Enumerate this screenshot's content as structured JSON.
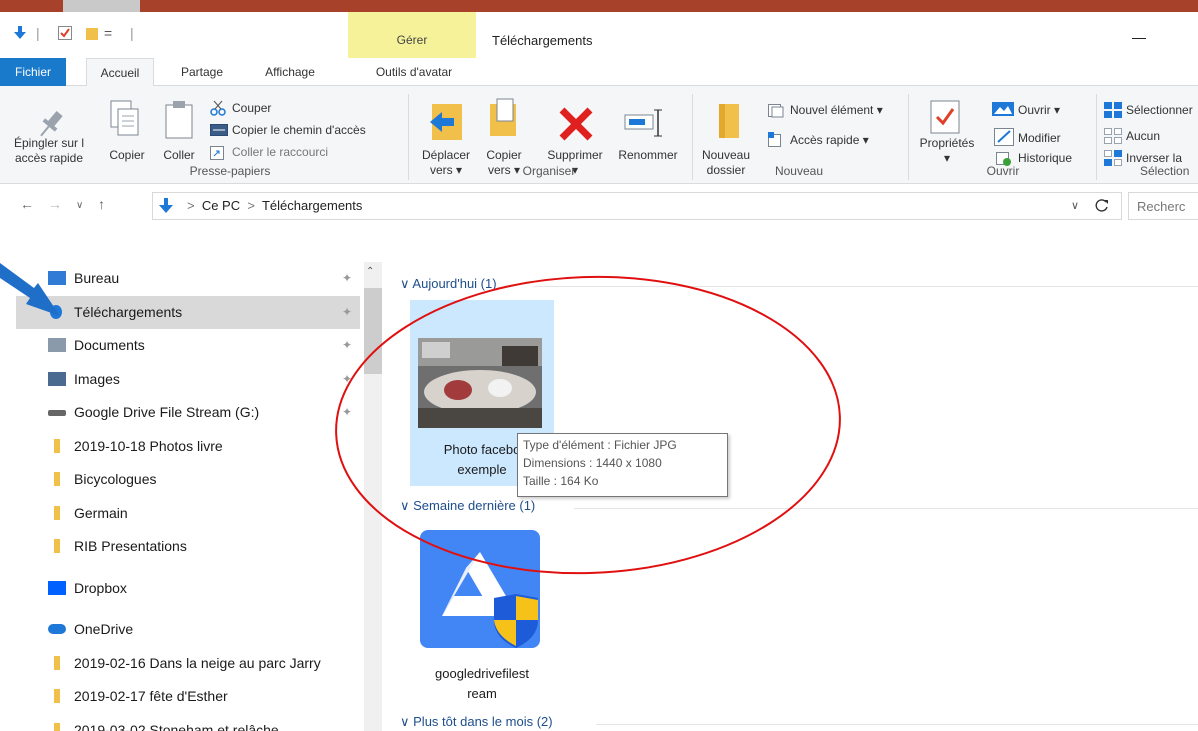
{
  "window": {
    "title": "Téléchargements",
    "context_tab_group": "Gérer",
    "accent_color": "#a8412a"
  },
  "quick_access": {
    "separator": "|",
    "dropdown": "="
  },
  "ribbon_tabs": [
    {
      "label": "Fichier"
    },
    {
      "label": "Accueil"
    },
    {
      "label": "Partage"
    },
    {
      "label": "Affichage"
    },
    {
      "label": "Outils d'avatar"
    }
  ],
  "ribbon": {
    "presse_papiers": {
      "label": "Presse-papiers",
      "pin_line1": "Épingler sur l",
      "pin_line2": "accès rapide",
      "copy": "Copier",
      "paste": "Coller",
      "cut": "Couper",
      "copy_path": "Copier le chemin d'accès",
      "paste_shortcut": "Coller le raccourci"
    },
    "organiser": {
      "label": "Organiser",
      "move_line1": "Déplacer",
      "move_line2": "vers ▾",
      "copy_line1": "Copier",
      "copy_line2": "vers ▾",
      "delete": "Supprimer",
      "delete_arrow": "▾",
      "rename": "Renommer"
    },
    "nouveau": {
      "label": "Nouveau",
      "new_folder_line1": "Nouveau",
      "new_folder_line2": "dossier",
      "new_item": "Nouvel élément ▾",
      "quick_access": "Accès rapide ▾"
    },
    "ouvrir": {
      "label": "Ouvrir",
      "properties": "Propriétés",
      "properties_arrow": "▾",
      "open": "Ouvrir ▾",
      "edit": "Modifier",
      "history": "Historique"
    },
    "selection": {
      "label": "Sélection",
      "select_all": "Sélectionner",
      "none": "Aucun",
      "invert": "Inverser la"
    }
  },
  "address": {
    "path": [
      "Ce PC",
      "Téléchargements"
    ],
    "sep": ">",
    "search_placeholder": "Recherc"
  },
  "nav_items": [
    {
      "label": "Bureau",
      "icon": "desktop-icon",
      "pinned": true
    },
    {
      "label": "Téléchargements",
      "icon": "download-icon",
      "pinned": true,
      "selected": true
    },
    {
      "label": "Documents",
      "icon": "documents-icon",
      "pinned": true
    },
    {
      "label": "Images",
      "icon": "images-icon",
      "pinned": true
    },
    {
      "label": "Google Drive File Stream (G:)",
      "icon": "drive-icon",
      "pinned": true
    },
    {
      "label": "2019-10-18 Photos livre",
      "icon": "folder-icon"
    },
    {
      "label": "Bicycologues",
      "icon": "folder-icon"
    },
    {
      "label": "Germain",
      "icon": "folder-icon"
    },
    {
      "label": "RIB Presentations",
      "icon": "folder-icon"
    },
    {
      "label": "Dropbox",
      "icon": "dropbox-icon"
    },
    {
      "label": "OneDrive",
      "icon": "onedrive-icon"
    },
    {
      "label": "2019-02-16 Dans la neige au parc Jarry",
      "icon": "folder-icon"
    },
    {
      "label": "2019-02-17  fête d'Esther",
      "icon": "folder-icon"
    },
    {
      "label": "2019-03-02 Stoneham et relâche",
      "icon": "folder-icon"
    }
  ],
  "content": {
    "groups": [
      {
        "label": "Aujourd'hui (1)"
      },
      {
        "label": "Semaine dernière (1)"
      },
      {
        "label": "Plus tôt dans le mois (2)"
      }
    ],
    "files": [
      {
        "line1": "Photo facebo",
        "line2": "exemple"
      },
      {
        "line1": "googledrivefilest",
        "line2": "ream"
      }
    ],
    "tooltip": {
      "type": "Type d'élément : Fichier JPG",
      "dimensions": "Dimensions : 1440 x 1080",
      "size": "Taille : 164 Ko"
    }
  },
  "annotations": {
    "arrow_color": "#1f6fc9",
    "circle_color": "#e01010"
  }
}
